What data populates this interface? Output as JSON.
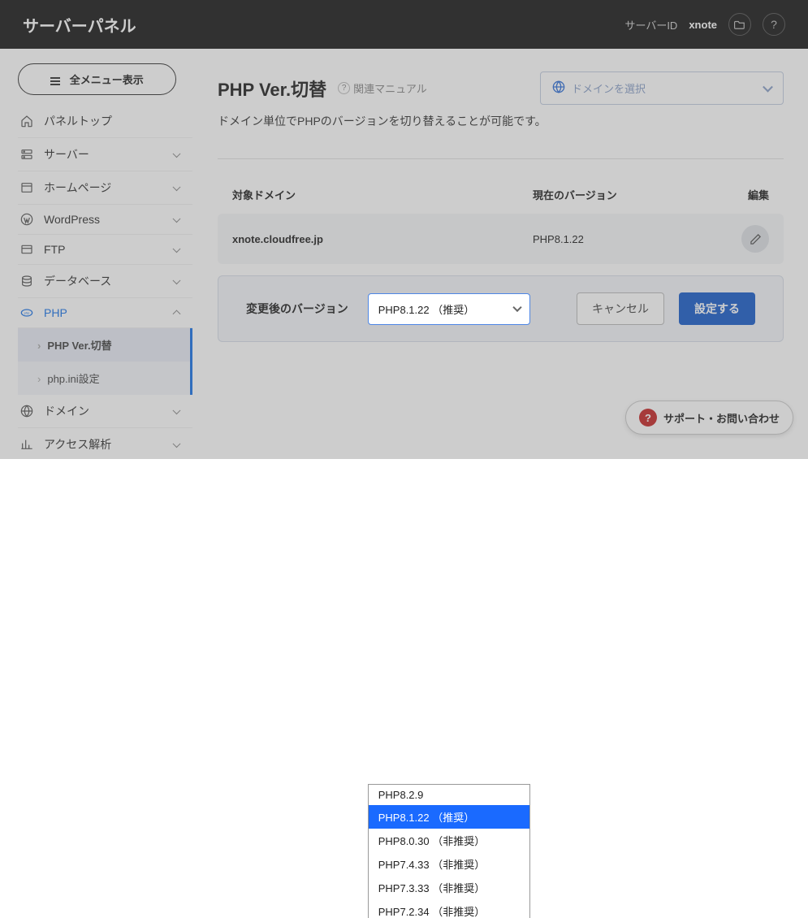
{
  "header": {
    "title": "サーバーパネル",
    "server_id_label": "サーバーID",
    "server_id_value": "xnote"
  },
  "sidebar": {
    "all_menu_btn": "全メニュー表示",
    "items": [
      {
        "icon": "home",
        "label": "パネルトップ",
        "hasChildren": false
      },
      {
        "icon": "server",
        "label": "サーバー",
        "hasChildren": true
      },
      {
        "icon": "window",
        "label": "ホームページ",
        "hasChildren": true
      },
      {
        "icon": "wp",
        "label": "WordPress",
        "hasChildren": true
      },
      {
        "icon": "ftp",
        "label": "FTP",
        "hasChildren": true
      },
      {
        "icon": "db",
        "label": "データベース",
        "hasChildren": true
      },
      {
        "icon": "php",
        "label": "PHP",
        "hasChildren": true,
        "expanded": true,
        "active": true
      },
      {
        "icon": "globe",
        "label": "ドメイン",
        "hasChildren": true
      },
      {
        "icon": "chart",
        "label": "アクセス解析",
        "hasChildren": true
      }
    ],
    "php_sub": [
      {
        "label": "PHP Ver.切替",
        "active": true
      },
      {
        "label": "php.ini設定",
        "active": false
      }
    ]
  },
  "page": {
    "title": "PHP Ver.切替",
    "manual_link": "関連マニュアル",
    "domain_select_placeholder": "ドメインを選択",
    "description": "ドメイン単位でPHPのバージョンを切り替えることが可能です。",
    "col_domain": "対象ドメイン",
    "col_version": "現在のバージョン",
    "col_edit": "編集",
    "row_domain": "xnote.cloudfree.jp",
    "row_version": "PHP8.1.22",
    "edit": {
      "label": "変更後のバージョン",
      "selected": "PHP8.1.22 （推奨）",
      "cancel": "キャンセル",
      "submit": "設定する"
    },
    "options": [
      "PHP8.2.9",
      "PHP8.1.22 （推奨）",
      "PHP8.0.30 （非推奨）",
      "PHP7.4.33 （非推奨）",
      "PHP7.3.33 （非推奨）",
      "PHP7.2.34 （非推奨）"
    ]
  },
  "support_fab": "サポート・お問い合わせ"
}
